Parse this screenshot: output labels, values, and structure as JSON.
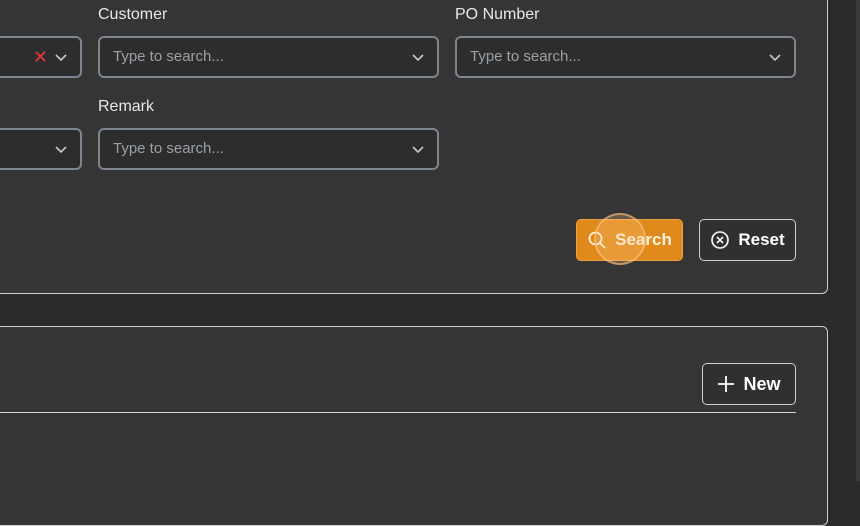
{
  "filters": {
    "customer": {
      "label": "Customer",
      "placeholder": "Type to search..."
    },
    "po_number": {
      "label": "PO Number",
      "placeholder": "Type to search..."
    },
    "remark": {
      "label": "Remark",
      "placeholder": "Type to search..."
    }
  },
  "actions": {
    "search_label": "Search",
    "reset_label": "Reset",
    "new_label": "New"
  },
  "colors": {
    "accent": "#e08a1c",
    "clear": "#e53935"
  },
  "icons": {
    "search": "search-icon",
    "reset": "close-circle-icon",
    "new": "plus-icon",
    "dropdown": "chevron-down-icon",
    "clear": "clear-x-icon"
  }
}
